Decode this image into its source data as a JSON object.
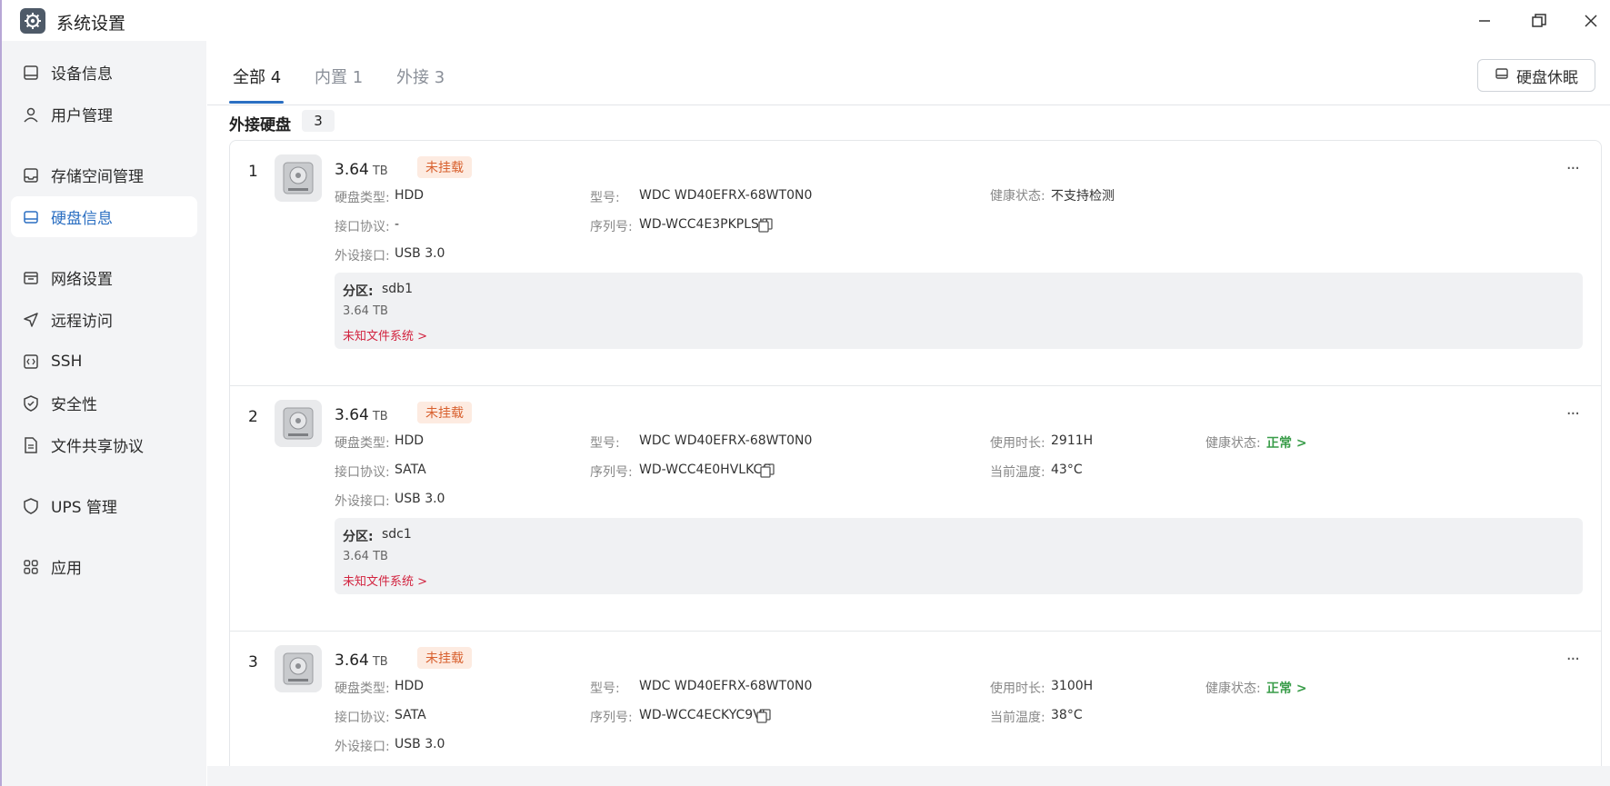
{
  "app": {
    "title": "系统设置",
    "icon": "gear-icon"
  },
  "window_controls": {
    "minimize": "minimize-icon",
    "maximize": "maximize-icon",
    "close": "close-icon"
  },
  "sidebar": {
    "items": [
      {
        "label": "设备信息",
        "icon": "monitor-icon",
        "active": false
      },
      {
        "label": "用户管理",
        "icon": "user-icon",
        "active": false
      },
      {
        "label": "存储空间管理",
        "icon": "storage-icon",
        "active": false
      },
      {
        "label": "硬盘信息",
        "icon": "disk-icon",
        "active": true
      },
      {
        "label": "网络设置",
        "icon": "network-icon",
        "active": false
      },
      {
        "label": "远程访问",
        "icon": "send-icon",
        "active": false
      },
      {
        "label": "SSH",
        "icon": "code-icon",
        "active": false
      },
      {
        "label": "安全性",
        "icon": "shield-icon",
        "active": false
      },
      {
        "label": "文件共享协议",
        "icon": "document-icon",
        "active": false
      },
      {
        "label": "UPS 管理",
        "icon": "shield-outline-icon",
        "active": false
      },
      {
        "label": "应用",
        "icon": "apps-grid-icon",
        "active": false
      }
    ]
  },
  "tabs": [
    {
      "label": "全部 4",
      "active": true
    },
    {
      "label": "内置 1",
      "active": false
    },
    {
      "label": "外接 3",
      "active": false
    }
  ],
  "sleep_button": {
    "label": "硬盘休眠",
    "icon": "disk-sleep-icon"
  },
  "section": {
    "title": "外接硬盘",
    "count": "3"
  },
  "labels": {
    "disk_type": "硬盘类型:",
    "interface": "接口协议:",
    "external_port": "外设接口:",
    "model": "型号:",
    "serial": "序列号:",
    "health": "健康状态:",
    "usage_time": "使用时长:",
    "temperature": "当前温度:",
    "partition": "分区:",
    "size_unit": "TB",
    "unmounted": "未挂载",
    "more": "···"
  },
  "disks": [
    {
      "index": "1",
      "size": "3.64",
      "status": "未挂载",
      "disk_type": "HDD",
      "interface": "-",
      "external_port": "USB 3.0",
      "model": "WDC WD40EFRX-68WT0N0",
      "serial": "WD-WCC4E3PKPLSH",
      "health": "不支持检测",
      "partition": {
        "name": "sdb1",
        "size": "3.64 TB",
        "fs": "未知文件系统 >"
      }
    },
    {
      "index": "2",
      "size": "3.64",
      "status": "未挂载",
      "disk_type": "HDD",
      "interface": "SATA",
      "external_port": "USB 3.0",
      "model": "WDC WD40EFRX-68WT0N0",
      "serial": "WD-WCC4E0HVLKCC",
      "usage_time": "2911H",
      "temperature": "43°C",
      "health": "正常 >",
      "partition": {
        "name": "sdc1",
        "size": "3.64 TB",
        "fs": "未知文件系统 >"
      }
    },
    {
      "index": "3",
      "size": "3.64",
      "status": "未挂载",
      "disk_type": "HDD",
      "interface": "SATA",
      "external_port": "USB 3.0",
      "model": "WDC WD40EFRX-68WT0N0",
      "serial": "WD-WCC4ECKYC9VJ",
      "usage_time": "3100H",
      "temperature": "38°C",
      "health": "正常 >"
    }
  ],
  "colors": {
    "accent": "#2b6fc2",
    "badge_bg": "#fdebe1",
    "badge_text": "#d8602e",
    "health_ok": "#3a9d4a",
    "fs_unknown": "#d2233f"
  }
}
